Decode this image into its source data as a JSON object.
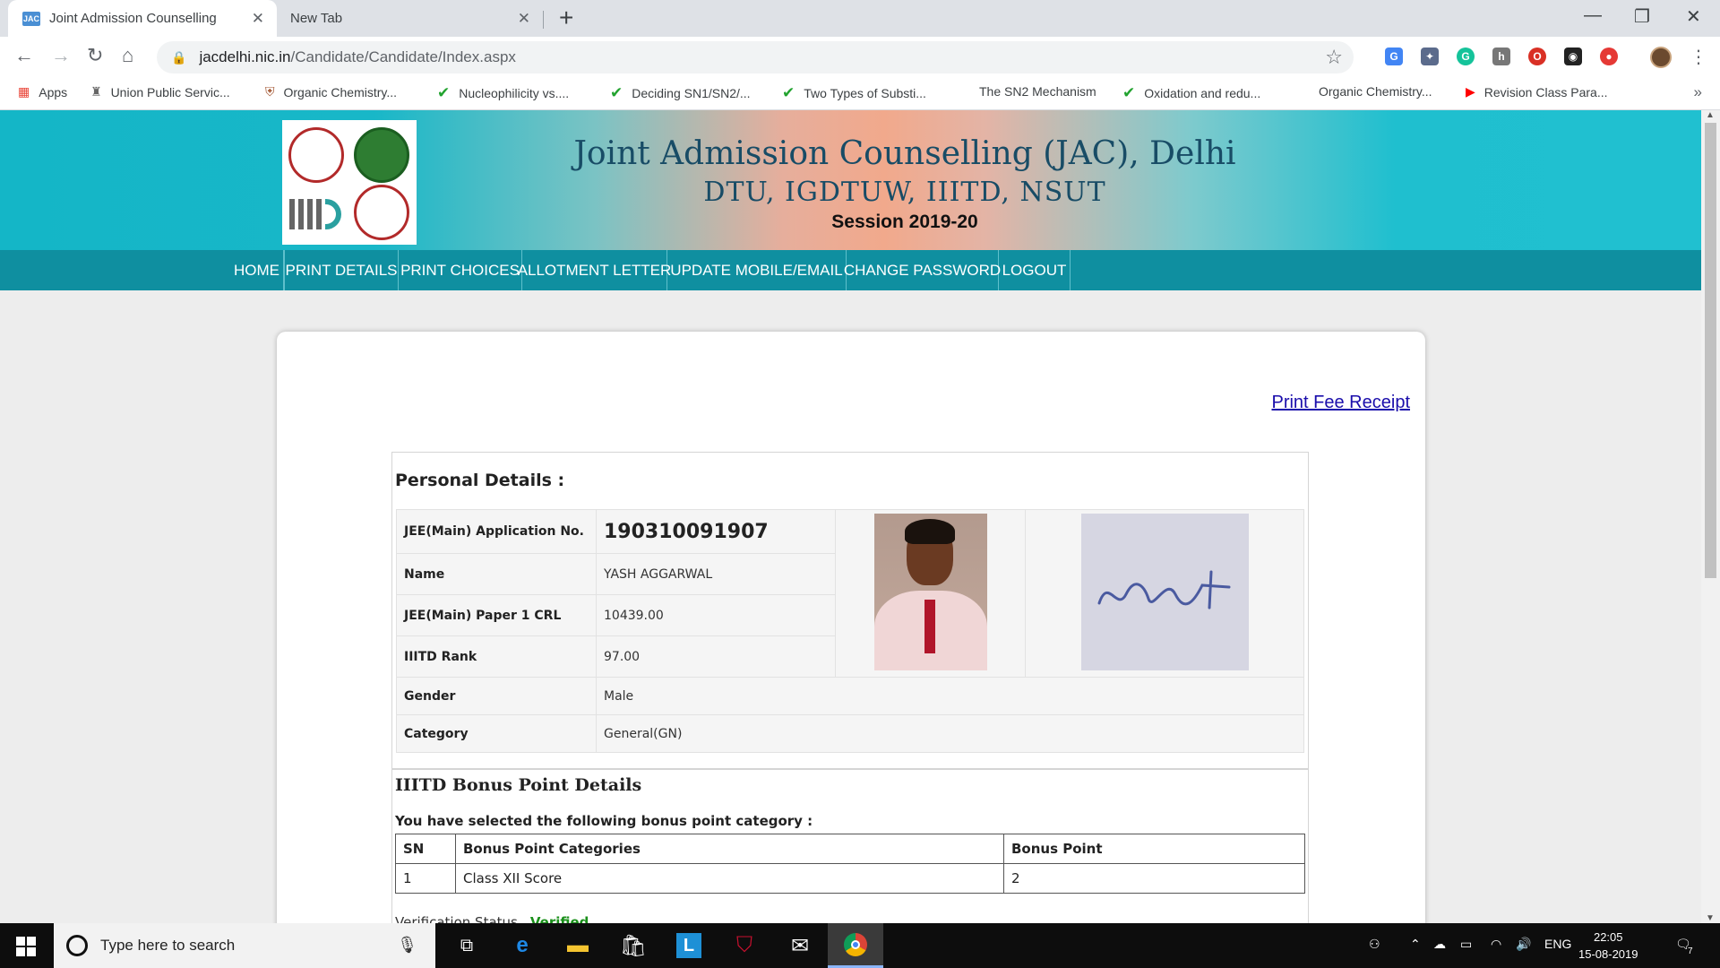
{
  "browser": {
    "tabs": [
      {
        "favicon": "JAC",
        "title": "Joint Admission Counselling",
        "close": "✕"
      },
      {
        "title": "New Tab",
        "close": "✕"
      }
    ],
    "new_tab": "+",
    "url_host": "jacdelhi.nic.in",
    "url_path": "/Candidate/Candidate/Index.aspx",
    "window_controls": {
      "minimize": "—",
      "restore": "❐",
      "close": "✕"
    }
  },
  "bookmarks": [
    {
      "icon": "apps-icon",
      "label": "Apps"
    },
    {
      "icon": "emblem-icon",
      "label": "Union Public Servic..."
    },
    {
      "icon": "crest-icon",
      "label": "Organic Chemistry..."
    },
    {
      "icon": "check-icon",
      "label": "Nucleophilicity vs...."
    },
    {
      "icon": "check-icon",
      "label": "Deciding SN1/SN2/..."
    },
    {
      "icon": "check-icon",
      "label": "Two Types of Substi..."
    },
    {
      "icon": "none",
      "label": "The SN2 Mechanism"
    },
    {
      "icon": "check-icon",
      "label": "Oxidation and redu..."
    },
    {
      "icon": "none",
      "label": "Organic Chemistry..."
    },
    {
      "icon": "youtube-icon",
      "label": "Revision Class Para..."
    }
  ],
  "banner": {
    "title": "Joint Admission Counselling (JAC), Delhi",
    "subtitle": "DTU, IGDTUW, IIITD, NSUT",
    "session": "Session 2019-20"
  },
  "nav": [
    "HOME",
    "PRINT DETAILS",
    "PRINT CHOICES",
    "ALLOTMENT LETTER",
    "UPDATE MOBILE/EMAIL",
    "CHANGE PASSWORD",
    "LOGOUT"
  ],
  "page": {
    "print_fee_receipt": "Print Fee Receipt",
    "personal_title": "Personal Details :",
    "personal": {
      "app_no_label": "JEE(Main) Application No.",
      "app_no": "190310091907",
      "name_label": "Name",
      "name": "YASH AGGARWAL",
      "crl_label": "JEE(Main) Paper 1 CRL",
      "crl": "10439.00",
      "rank_label": "IIITD Rank",
      "rank": "97.00",
      "gender_label": "Gender",
      "gender": "Male",
      "category_label": "Category",
      "category": "General(GN)"
    },
    "bonus_title": "IIITD Bonus Point Details",
    "bonus_sub": "You have selected the following bonus point category :",
    "bonus_headers": [
      "SN",
      "Bonus Point Categories",
      "Bonus Point"
    ],
    "bonus_rows": [
      [
        "1",
        "Class XII Score",
        "2"
      ]
    ],
    "verification_label": "Verification Status",
    "verification_value": "Verified"
  },
  "taskbar": {
    "search_placeholder": "Type here to search",
    "lang": "ENG",
    "time": "22:05",
    "date": "15-08-2019",
    "notifications": "7"
  }
}
